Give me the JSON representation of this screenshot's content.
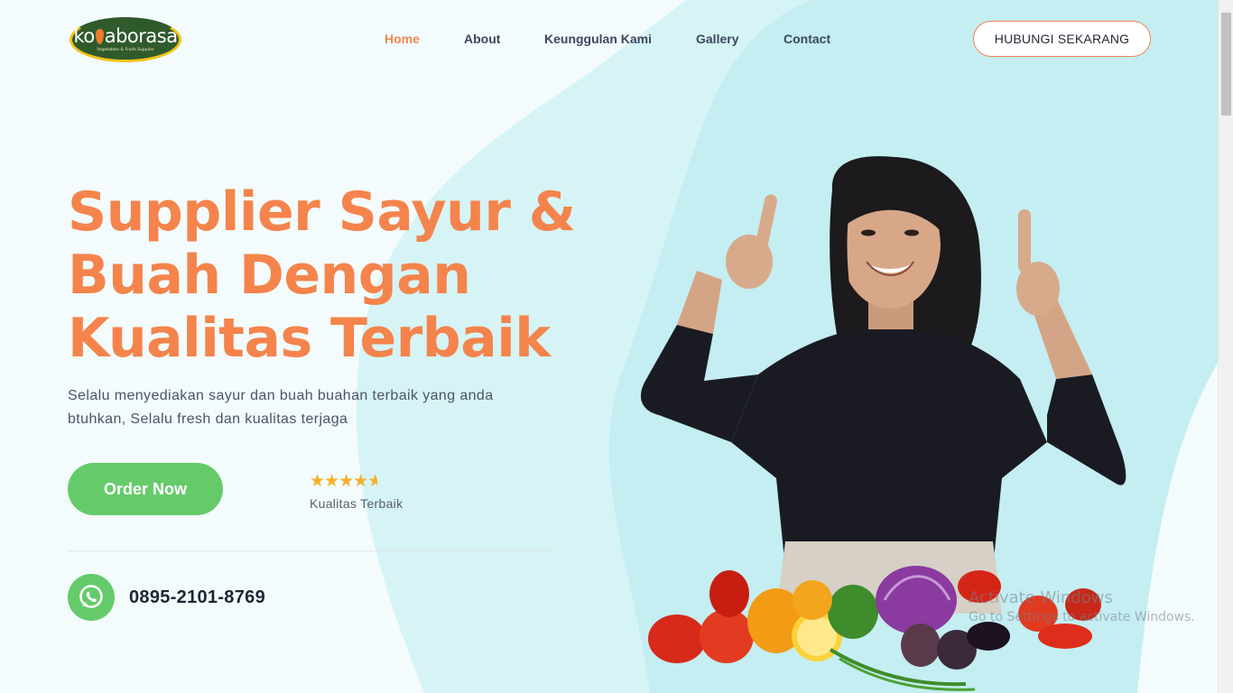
{
  "brand": {
    "logo_text": "ko aborasa",
    "logo_tagline": "Vegetables & Fruits Supplier"
  },
  "nav": {
    "items": [
      {
        "label": "Home",
        "active": true
      },
      {
        "label": "About",
        "active": false
      },
      {
        "label": "Keunggulan Kami",
        "active": false
      },
      {
        "label": "Gallery",
        "active": false
      },
      {
        "label": "Contact",
        "active": false
      }
    ],
    "cta_label": "HUBUNGI SEKARANG"
  },
  "hero": {
    "title_line1": "Supplier Sayur &",
    "title_line2": "Buah Dengan",
    "title_line3": "Kualitas Terbaik",
    "subtitle": "Selalu menyediakan sayur dan buah buahan terbaik yang anda btuhkan, Selalu fresh dan kualitas terjaga",
    "order_button": "Order Now",
    "rating_stars": 4.5,
    "rating_label": "Kualitas Terbaik",
    "phone": "0895-2101-8769"
  },
  "watermark": {
    "title": "Activate Windows",
    "subtitle": "Go to Settings to activate Windows."
  },
  "colors": {
    "accent": "#f4844c",
    "green": "#65cb6a",
    "blob": "#c6eff1",
    "background": "#f3fbfc"
  }
}
